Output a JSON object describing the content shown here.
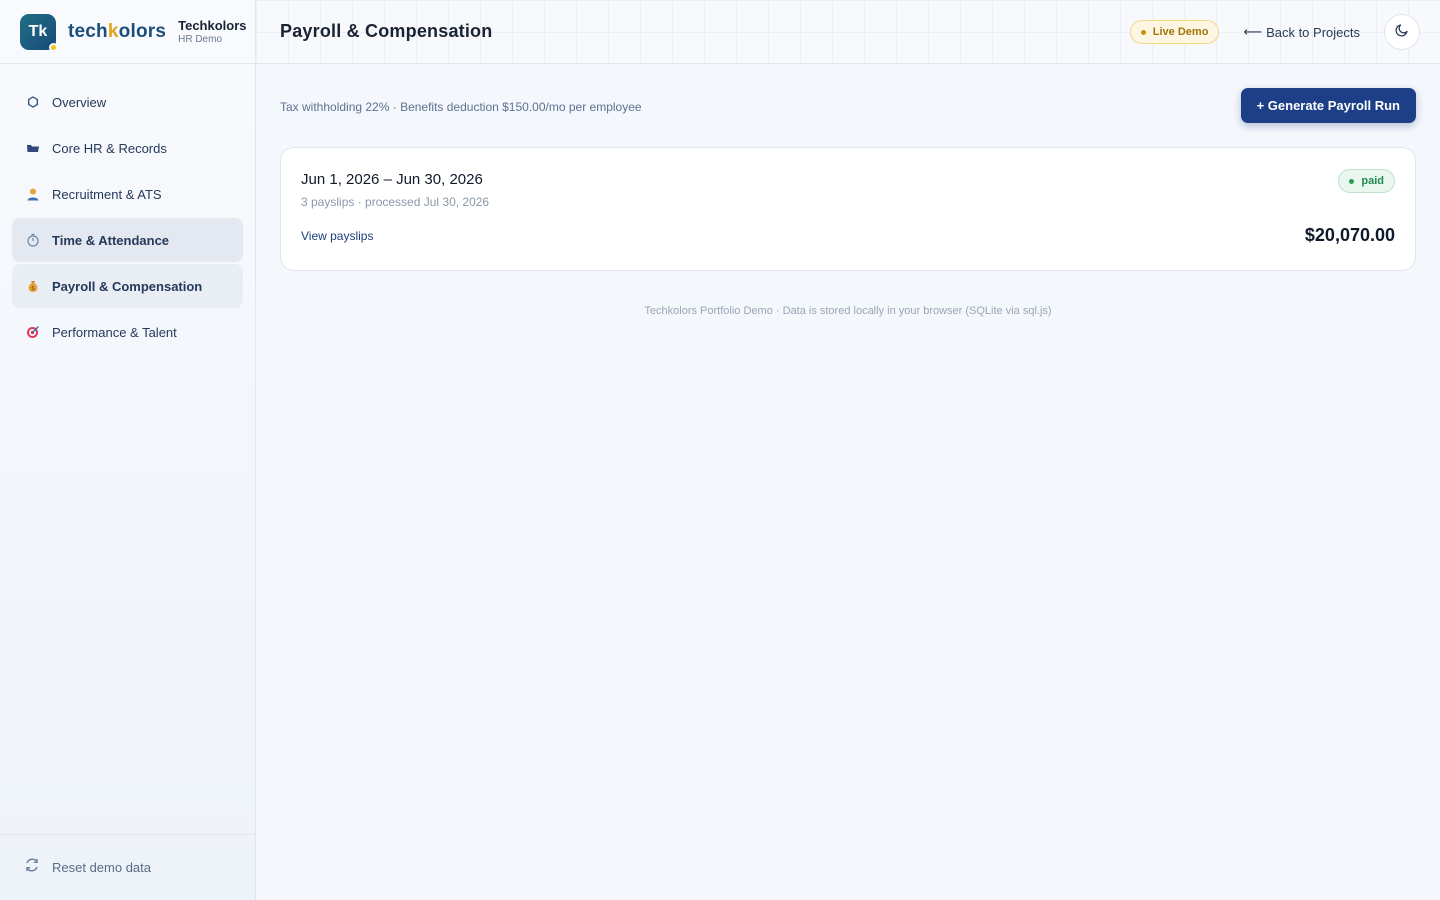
{
  "brand": {
    "logo_initials": "Tk",
    "wordmark_pre": "tech",
    "wordmark_k": "k",
    "wordmark_post": "olors",
    "title": "Techkolors",
    "subtitle": "HR Demo"
  },
  "sidebar": {
    "items": [
      {
        "label": "Overview",
        "icon": "hexagon-icon"
      },
      {
        "label": "Core HR & Records",
        "icon": "folder-icon"
      },
      {
        "label": "Recruitment & ATS",
        "icon": "person-icon"
      },
      {
        "label": "Time & Attendance",
        "icon": "stopwatch-icon"
      },
      {
        "label": "Payroll & Compensation",
        "icon": "money-bag-icon"
      },
      {
        "label": "Performance & Talent",
        "icon": "target-icon"
      }
    ],
    "reset_label": "Reset demo data"
  },
  "header": {
    "title": "Payroll & Compensation",
    "live_badge": "Live Demo",
    "back_label": "Back to Projects"
  },
  "main": {
    "note": "Tax withholding 22% · Benefits deduction $150.00/mo per employee",
    "generate_label": "+ Generate Payroll Run",
    "runs": [
      {
        "period": "Jun 1, 2026 – Jun 30, 2026",
        "meta": "3 payslips · processed Jul 30, 2026",
        "status": "paid",
        "amount": "$20,070.00",
        "view_label": "View payslips"
      }
    ],
    "footer": "Techkolors Portfolio Demo · Data is stored locally in your browser (SQLite via sql.js)"
  },
  "colors": {
    "primary": "#1d3f88",
    "accent": "#e3a41c",
    "paid": "#1f8a4c"
  }
}
